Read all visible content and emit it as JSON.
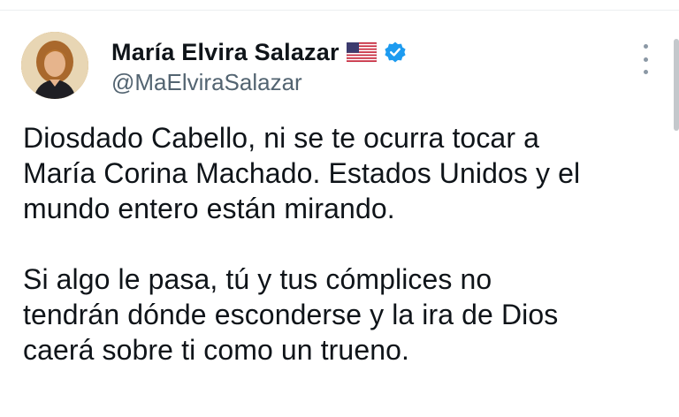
{
  "author": {
    "display_name": "María Elvira Salazar",
    "handle": "@MaElviraSalazar",
    "flag_icon": "us-flag-icon",
    "verified_icon": "verified-badge-icon",
    "verified_color": "#1d9bf0"
  },
  "tweet": {
    "paragraphs": [
      "Diosdado Cabello, ni se te ocurra tocar a\nMaría Corina Machado. Estados Unidos y el\nmundo entero están mirando.",
      "Si algo le pasa, tú y tus cómplices no\ntendrán dónde esconderse y la ira de Dios\ncaerá sobre ti como un trueno."
    ]
  },
  "icons": {
    "more": "more-options-icon"
  }
}
